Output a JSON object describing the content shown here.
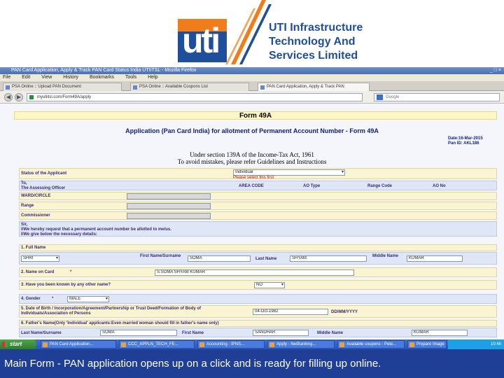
{
  "logo": {
    "mark": "uti",
    "company_line1": "UTI Infrastructure",
    "company_line2": "Technology And",
    "company_line3": "Services Limited"
  },
  "browser": {
    "title": "PAN Card Application, Apply & Track PAN Card Status India UTIITSL - Mozilla Firefox",
    "window_controls": "_ □ ×",
    "menu": [
      "File",
      "Edit",
      "View",
      "History",
      "Bookmarks",
      "Tools",
      "Help"
    ],
    "tabs": [
      "PSA Online :: Upload PAN Document",
      "PSA Online :: Available Coupons List",
      "PAN Card Application, Apply & Track PAN"
    ],
    "url": "myutiitsl.com/Form49A/apply",
    "search_placeholder": "Google",
    "back": "◀",
    "forward": "▶"
  },
  "form": {
    "heading": "Form 49A",
    "title": "Application (Pan Card India) for allotment of Permanent Account Number - Form 49A",
    "date": "Date:16-Mar-2015",
    "pan_id": "Pan ID: AKL186",
    "under1": "Under section 139A of the Income-Tax Act, 1961",
    "under2": "To avoid mistakes, please refer Guidelines and Instructions",
    "status_label": "Status of the Applicant",
    "status_value": "Individual",
    "status_hint": "Please select this first",
    "to_label": "To,",
    "ao_label": "The Assessing Officer",
    "area_code": "AREA CODE",
    "ao_type": "AO Type",
    "range_code": "Range Code",
    "ao_no": "AO No",
    "ward": "WARD/CIRCLE",
    "range": "Range",
    "commissioner": "Commissioner",
    "sir": "Sir,",
    "request1": "I/We hereby request that a permanent account number be allotted to me/us.",
    "request2": "I/We give below the necessary details:",
    "full_name": "1. Full Name",
    "title_value": "SHRI",
    "first_name_label": "First Name/Surname",
    "first_name_value": "SOMA",
    "last_name_label": "Last Name",
    "last_name_value": "SHYAM",
    "middle_name_label": "Middle Name",
    "middle_name_value": "KUMAR",
    "name_on_card": "2. Name on Card",
    "name_on_card_value": "S.SOMA SHYAM KUMAR",
    "other_name": "3. Have you been known by any other name?",
    "other_name_value": "NO",
    "gender": "4. Gender",
    "gender_value": "MALE",
    "dob": "5. Date of Birth / Incorporation/Agreement/Partnership or Trust Deed/Formation of Body of Individuals/Association of Persons",
    "dob_value": "04-Oct-1982",
    "dob_format": "DD/MM/YYYY",
    "father": "6. Father's Name(Only 'Individual' applicants:Even married woman should fill in father's name only)",
    "father_last": "Last Name/Surname",
    "father_last_value": "SOMA",
    "father_first": "First Name",
    "father_first_value": "SANDHAR",
    "father_middle": "Middle Name",
    "father_middle_value": "KUMAR"
  },
  "taskbar": {
    "start": "start",
    "items": [
      "PAN Card Application...",
      "CCC_APPLN_TECH_FE...",
      "Accounting - IPNS...",
      "Apply - NetBanking...",
      "Available coupons - Pete...",
      "Prepare Image"
    ],
    "clock": "10:46"
  },
  "caption": "Main Form - PAN application opens up on a click and is ready for filling up online."
}
